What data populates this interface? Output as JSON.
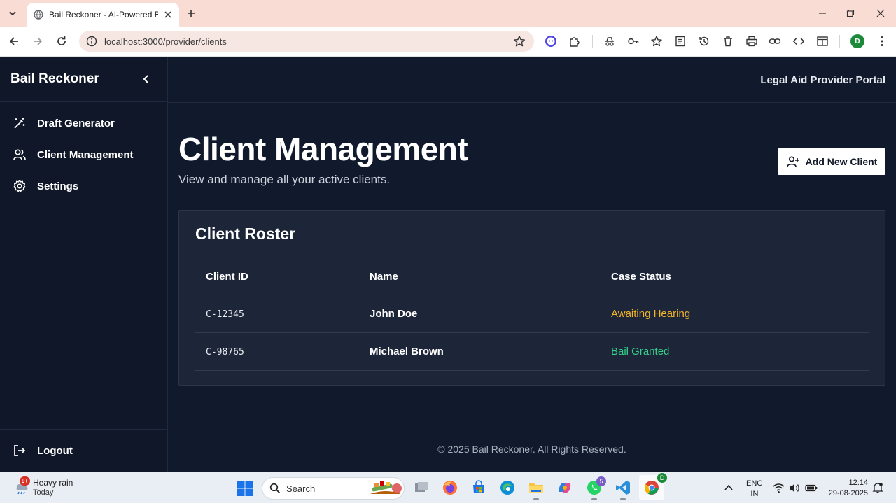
{
  "browser": {
    "tab_title": "Bail Reckoner - AI-Powered Bail",
    "url": "localhost:3000/provider/clients",
    "profile_initial": "D"
  },
  "sidebar": {
    "brand": "Bail Reckoner",
    "items": [
      {
        "label": "Draft Generator",
        "icon": "magic-wand-icon"
      },
      {
        "label": "Client Management",
        "icon": "users-icon"
      },
      {
        "label": "Settings",
        "icon": "gear-icon"
      }
    ],
    "logout_label": "Logout"
  },
  "header": {
    "portal_title": "Legal Aid Provider Portal"
  },
  "main": {
    "title": "Client Management",
    "subtitle": "View and manage all your active clients.",
    "add_button_label": "Add New Client"
  },
  "roster": {
    "title": "Client Roster",
    "columns": [
      "Client ID",
      "Name",
      "Case Status"
    ],
    "rows": [
      {
        "id": "C-12345",
        "name": "John Doe",
        "status": "Awaiting Hearing",
        "status_color": "#f4b429"
      },
      {
        "id": "C-98765",
        "name": "Michael Brown",
        "status": "Bail Granted",
        "status_color": "#35d08a"
      }
    ]
  },
  "footer": {
    "text": "© 2025 Bail Reckoner. All Rights Reserved."
  },
  "taskbar": {
    "weather_badge": "9+",
    "weather_line1": "Heavy rain",
    "weather_line2": "Today",
    "search_label": "Search",
    "whatsapp_badge": "5",
    "lang_line1": "ENG",
    "lang_line2": "IN",
    "time": "12:14",
    "date": "29-08-2025"
  },
  "colors": {
    "background": "#0f1729",
    "awaiting": "#f4b429",
    "granted": "#35d08a",
    "tabstrip": "#f9dcd3"
  }
}
